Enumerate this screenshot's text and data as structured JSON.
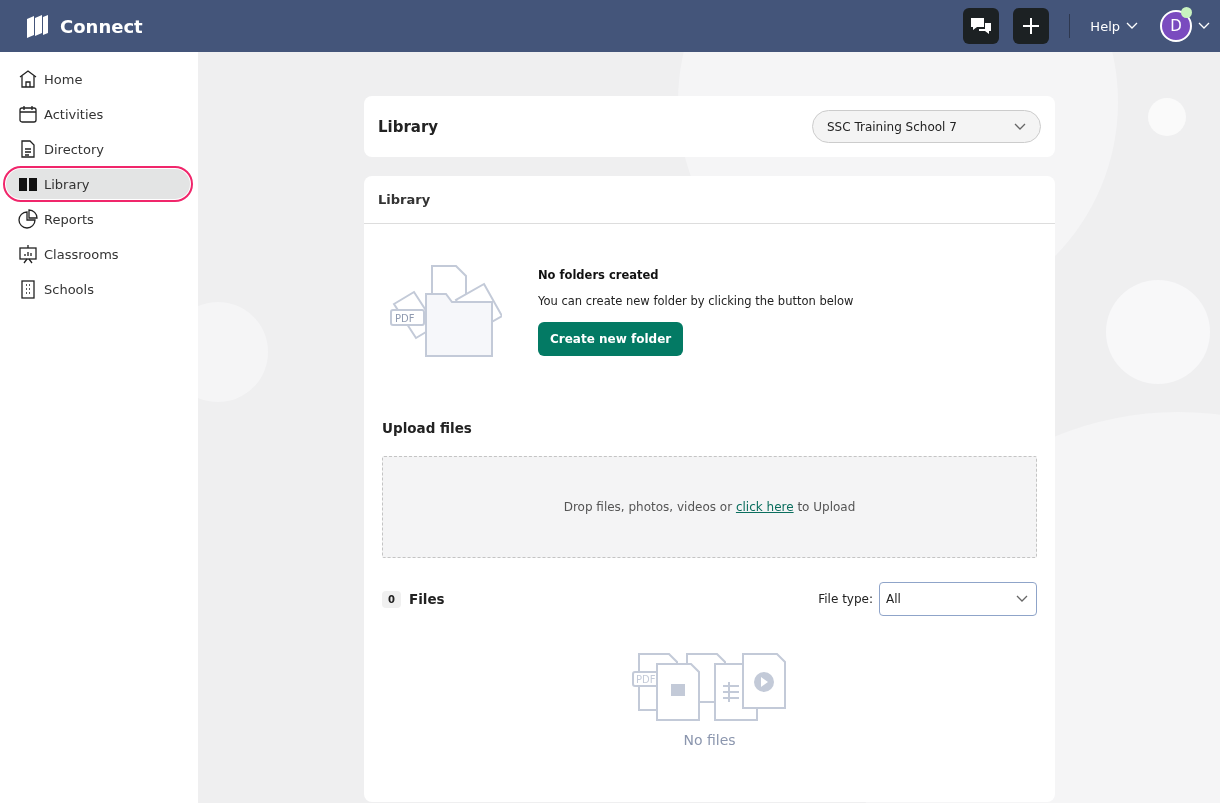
{
  "header": {
    "brand": "Connect",
    "help": "Help",
    "avatar": {
      "initial": "D",
      "online": true
    }
  },
  "sidebar": {
    "items": [
      {
        "label": "Home",
        "selected": false
      },
      {
        "label": "Activities",
        "selected": false
      },
      {
        "label": "Directory",
        "selected": false
      },
      {
        "label": "Library",
        "selected": true
      },
      {
        "label": "Reports",
        "selected": false
      },
      {
        "label": "Classrooms",
        "selected": false
      },
      {
        "label": "Schools",
        "selected": false
      }
    ]
  },
  "page": {
    "title": "Library",
    "school_select": {
      "value": "SSC Training School 7"
    }
  },
  "library": {
    "title": "Library",
    "folders_empty": {
      "illustration_label": "PDF",
      "title": "No folders created",
      "text": "You can create new folder by clicking the button below",
      "button": "Create new folder"
    },
    "upload": {
      "title": "Upload files",
      "before": "Drop files, photos, videos or",
      "link": "click here",
      "after": "to Upload"
    },
    "files": {
      "count": "0",
      "title": "Files",
      "filter_label": "File type:",
      "filter_value": "All",
      "empty": {
        "illustration_label": "PDF",
        "text": "No files"
      }
    }
  }
}
